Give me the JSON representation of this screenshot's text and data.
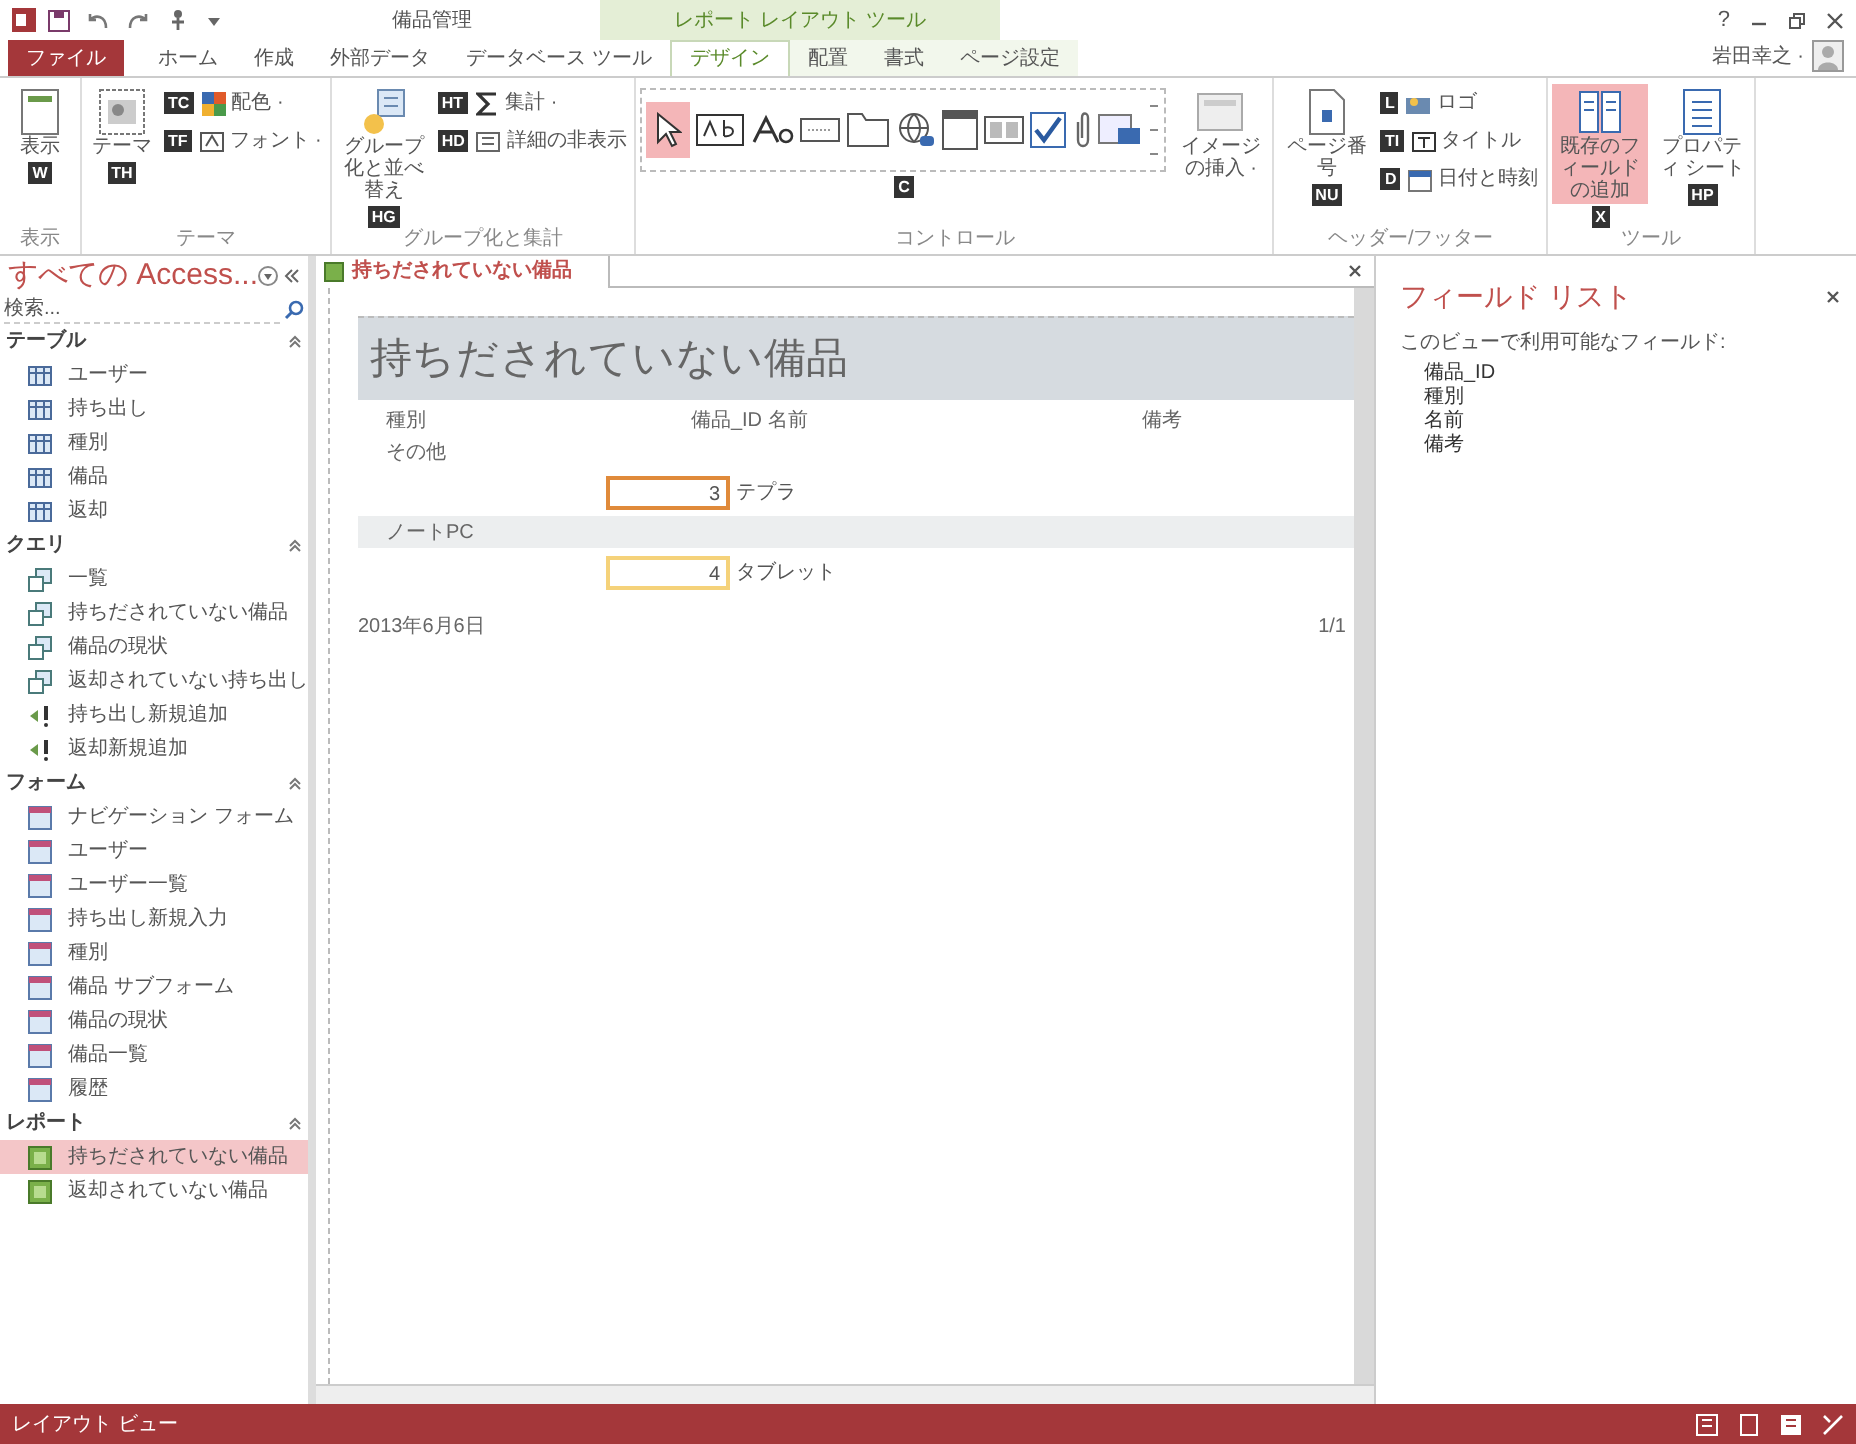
{
  "window": {
    "title": "備品管理",
    "tool_context": "レポート レイアウト ツール",
    "help": "?",
    "user": "岩田幸之 ·"
  },
  "ribbon_tabs": [
    {
      "label": "ファイル",
      "kind": "file",
      "selected": false
    },
    {
      "label": "ホーム",
      "kind": "tab",
      "selected": false
    },
    {
      "label": "作成",
      "kind": "tab",
      "selected": false
    },
    {
      "label": "外部データ",
      "kind": "tab",
      "selected": false
    },
    {
      "label": "データベース ツール",
      "kind": "tab",
      "selected": false
    },
    {
      "label": "デザイン",
      "kind": "context",
      "selected": true
    },
    {
      "label": "配置",
      "kind": "context",
      "selected": false
    },
    {
      "label": "書式",
      "kind": "context",
      "selected": false
    },
    {
      "label": "ページ設定",
      "kind": "context",
      "selected": false
    }
  ],
  "ribbon_groups": [
    {
      "label": "表示",
      "commands": [
        {
          "label": "表示",
          "kind": "large",
          "keytip": "W",
          "selected": false
        }
      ]
    },
    {
      "label": "テーマ",
      "commands": [
        {
          "label": "テーマ",
          "kind": "large",
          "keytip": "TH",
          "selected": false
        },
        {
          "label": "配色 ·",
          "kind": "small",
          "keytip": "TC",
          "selected": false
        },
        {
          "label": "フォント ·",
          "kind": "small",
          "keytip": "TF",
          "selected": false
        }
      ]
    },
    {
      "label": "グループ化と集計",
      "commands": [
        {
          "label": "グループ化と並べ替え",
          "kind": "large",
          "keytip": "HG",
          "selected": false
        },
        {
          "label": "集計 ·",
          "kind": "small",
          "keytip": "HT",
          "selected": false
        },
        {
          "label": "詳細の非表示",
          "kind": "small",
          "keytip": "HD",
          "selected": false
        }
      ]
    },
    {
      "label": "コントロール",
      "commands": [
        {
          "kind": "gallery",
          "keytip": "C"
        },
        {
          "label": "イメージの挿入 ·",
          "kind": "large",
          "selected": false
        }
      ]
    },
    {
      "label": "ヘッダー/フッター",
      "commands": [
        {
          "label": "ページ番号",
          "kind": "large",
          "keytip": "NU",
          "selected": false
        },
        {
          "label": "ロゴ",
          "kind": "small",
          "keytip": "L",
          "selected": false
        },
        {
          "label": "タイトル",
          "kind": "small",
          "keytip": "TI",
          "selected": false
        },
        {
          "label": "日付と時刻",
          "kind": "small",
          "keytip": "D",
          "selected": false
        }
      ]
    },
    {
      "label": "ツール",
      "commands": [
        {
          "label": "既存のフィールドの追加",
          "kind": "large",
          "keytip": "X",
          "selected": true
        },
        {
          "label": "プロパティ シート",
          "kind": "large",
          "keytip": "HP",
          "selected": false
        }
      ]
    }
  ],
  "navigation": {
    "title": "すべての Access...",
    "search": {
      "placeholder": "検索..."
    },
    "groups": [
      {
        "label": "テーブル",
        "items": [
          {
            "label": "ユーザー",
            "kind": "table",
            "selected": false
          },
          {
            "label": "持ち出し",
            "kind": "table",
            "selected": false
          },
          {
            "label": "種別",
            "kind": "table",
            "selected": false
          },
          {
            "label": "備品",
            "kind": "table",
            "selected": false
          },
          {
            "label": "返却",
            "kind": "table",
            "selected": false
          }
        ]
      },
      {
        "label": "クエリ",
        "items": [
          {
            "label": "一覧",
            "kind": "query",
            "selected": false
          },
          {
            "label": "持ちだされていない備品",
            "kind": "query",
            "selected": false
          },
          {
            "label": "備品の現状",
            "kind": "query",
            "selected": false
          },
          {
            "label": "返却されていない持ち出し",
            "kind": "query",
            "selected": false
          },
          {
            "label": "持ち出し新規追加",
            "kind": "append",
            "selected": false
          },
          {
            "label": "返却新規追加",
            "kind": "append",
            "selected": false
          }
        ]
      },
      {
        "label": "フォーム",
        "items": [
          {
            "label": "ナビゲーション フォーム",
            "kind": "form",
            "selected": false
          },
          {
            "label": "ユーザー",
            "kind": "form",
            "selected": false
          },
          {
            "label": "ユーザー一覧",
            "kind": "form",
            "selected": false
          },
          {
            "label": "持ち出し新規入力",
            "kind": "form",
            "selected": false
          },
          {
            "label": "種別",
            "kind": "form",
            "selected": false
          },
          {
            "label": "備品 サブフォーム",
            "kind": "form",
            "selected": false
          },
          {
            "label": "備品の現状",
            "kind": "form",
            "selected": false
          },
          {
            "label": "備品一覧",
            "kind": "form",
            "selected": false
          },
          {
            "label": "履歴",
            "kind": "form",
            "selected": false
          }
        ]
      },
      {
        "label": "レポート",
        "items": [
          {
            "label": "持ちだされていない備品",
            "kind": "report",
            "selected": true
          },
          {
            "label": "返却されていない備品",
            "kind": "report",
            "selected": false
          }
        ]
      }
    ]
  },
  "document_tab": {
    "label": "持ちだされていない備品"
  },
  "report": {
    "title": "持ちだされていない備品",
    "columns": [
      "種別",
      "備品_ID",
      "名前",
      "備考"
    ],
    "groups": [
      {
        "label": "その他",
        "banded": false,
        "rows": [
          {
            "id": "3",
            "name": "テプラ",
            "selected": true
          }
        ]
      },
      {
        "label": "ノートPC",
        "banded": true,
        "rows": [
          {
            "id": "4",
            "name": "タブレット",
            "selected": false
          }
        ]
      }
    ],
    "date": "2013年6月6日",
    "page": "1/1"
  },
  "field_list": {
    "title": "フィールド リスト",
    "subtitle": "このビューで利用可能なフィールド:",
    "fields": [
      "備品_ID",
      "種別",
      "名前",
      "備考"
    ]
  },
  "status_bar": {
    "text": "レイアウト ビュー"
  }
}
